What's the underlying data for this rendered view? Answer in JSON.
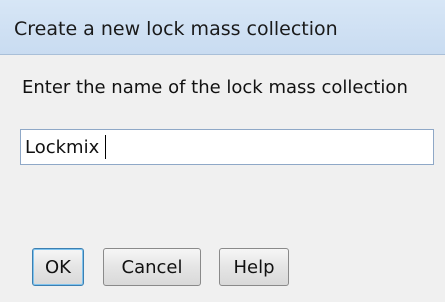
{
  "dialog": {
    "title": "Create a new lock mass collection",
    "prompt": "Enter the name of the lock mass collection",
    "name_field": {
      "value": "Lockmix"
    },
    "buttons": {
      "ok_label": "OK",
      "cancel_label": "Cancel",
      "help_label": "Help"
    }
  }
}
